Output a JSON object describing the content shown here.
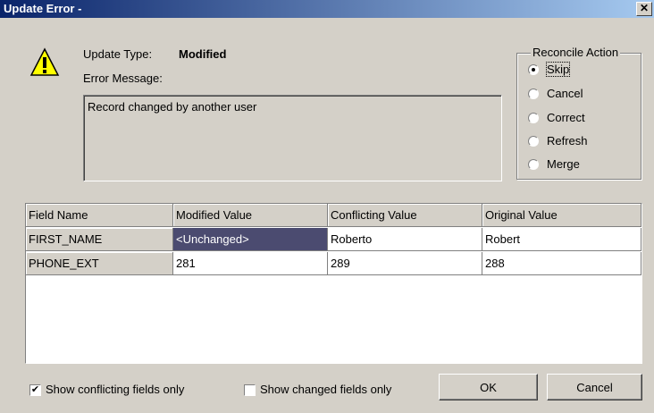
{
  "window": {
    "title": "Update Error -",
    "close_label": "✕"
  },
  "update_type": {
    "label": "Update Type:",
    "value": "Modified"
  },
  "error_message": {
    "label": "Error Message:",
    "text": "Record changed by another user"
  },
  "reconcile": {
    "title": "Reconcile Action",
    "options": [
      {
        "label": "Skip",
        "selected": true
      },
      {
        "label": "Cancel",
        "selected": false
      },
      {
        "label": "Correct",
        "selected": false
      },
      {
        "label": "Refresh",
        "selected": false
      },
      {
        "label": "Merge",
        "selected": false
      }
    ]
  },
  "grid": {
    "headers": [
      "Field Name",
      "Modified Value",
      "Conflicting Value",
      "Original Value"
    ],
    "rows": [
      [
        "FIRST_NAME",
        "<Unchanged>",
        "Roberto",
        "Robert"
      ],
      [
        "PHONE_EXT",
        "281",
        "289",
        "288"
      ]
    ]
  },
  "options": {
    "show_conflicting": {
      "label": "Show conflicting fields only",
      "checked": true,
      "mark": "✔"
    },
    "show_changed": {
      "label": "Show changed fields only",
      "checked": false
    }
  },
  "buttons": {
    "ok": "OK",
    "cancel": "Cancel"
  },
  "icons": {
    "warning": "warning-icon"
  }
}
